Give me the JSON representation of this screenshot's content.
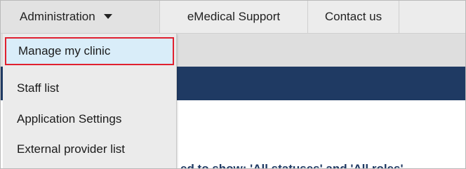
{
  "nav": {
    "admin_label": "Administration",
    "support_label": "eMedical Support",
    "contact_label": "Contact us"
  },
  "dropdown": {
    "items": [
      {
        "label": "Manage my clinic",
        "highlighted": true
      },
      {
        "label": "Staff list"
      },
      {
        "label": "Application Settings"
      },
      {
        "label": "External provider list"
      }
    ]
  },
  "page": {
    "filter_text": "ed to show: 'All statuses' and 'All roles'"
  },
  "colors": {
    "nav_bg": "#ececec",
    "blue_bar": "#1f3a63",
    "highlight_border": "#e0202f",
    "highlight_bg": "#d9edf9",
    "tab_orange": "#e8892f"
  }
}
